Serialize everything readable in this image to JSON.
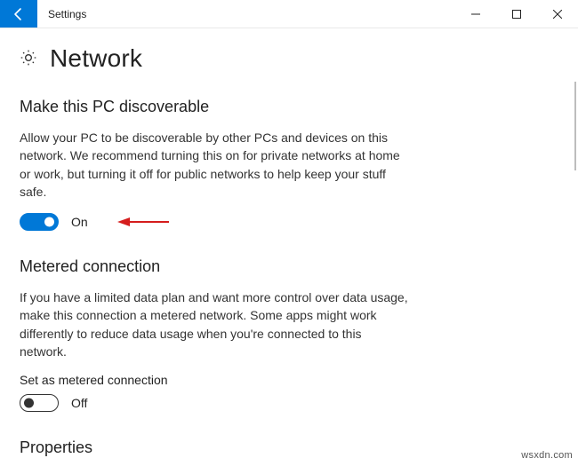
{
  "window": {
    "app_title": "Settings"
  },
  "page": {
    "title": "Network"
  },
  "sections": {
    "discoverable": {
      "heading": "Make this PC discoverable",
      "description": "Allow your PC to be discoverable by other PCs and devices on this network. We recommend turning this on for private networks at home or work, but turning it off for public networks to help keep your stuff safe.",
      "toggle_state": "On"
    },
    "metered": {
      "heading": "Metered connection",
      "description": "If you have a limited data plan and want more control over data usage, make this connection a metered network. Some apps might work differently to reduce data usage when you're connected to this network.",
      "field_label": "Set as metered connection",
      "toggle_state": "Off"
    },
    "properties": {
      "heading": "Properties"
    }
  },
  "watermark": "wsxdn.com"
}
